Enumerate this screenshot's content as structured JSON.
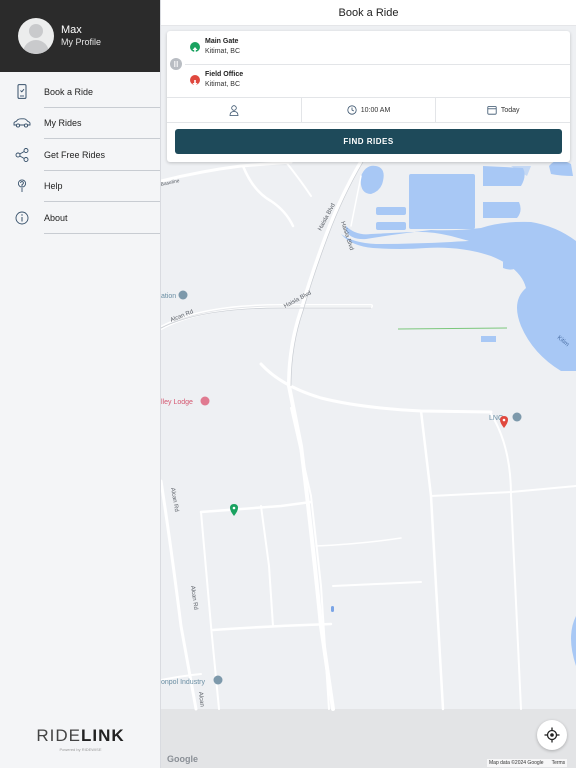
{
  "profile": {
    "name": "Max",
    "subtitle": "My Profile"
  },
  "menu": [
    {
      "label": "Book a Ride",
      "icon": "phone-icon"
    },
    {
      "label": "My Rides",
      "icon": "car-icon"
    },
    {
      "label": "Get Free Rides",
      "icon": "share-icon"
    },
    {
      "label": "Help",
      "icon": "help-icon"
    },
    {
      "label": "About",
      "icon": "info-icon"
    }
  ],
  "brand": {
    "name_light": "RIDE",
    "name_bold": "LINK",
    "powered_by": "Powered by RIDEWISE"
  },
  "header": {
    "title": "Book a Ride"
  },
  "ride": {
    "origin": {
      "name": "Main Gate",
      "city": "Kitimat, BC"
    },
    "destination": {
      "name": "Field Office",
      "city": "Kitimat, BC"
    },
    "time": "10:00 AM",
    "date": "Today",
    "find_label": "FIND RIDES"
  },
  "map_labels": {
    "haisla_blvd_1": "Haisla Blvd",
    "haisla_blvd_2": "Haisla Blvd",
    "haisla_blvd_3": "Haisla Blvd",
    "alcan_rd_1": "Alcan Rd",
    "alcan_rd_2": "Alcan Rd",
    "alcan_rd_3": "Alcan Rd",
    "alcan_rd_4": "Alcan",
    "station": "ation",
    "lodge": "lley Lodge",
    "lng": "LNG",
    "industry": "onpol Industry",
    "kitimat": "Kitim",
    "shoreline": "Baseline"
  },
  "attribution": {
    "map_data": "Map data ©2024 Google",
    "terms": "Terms",
    "logo": "Google"
  },
  "colors": {
    "sidebar_dark": "#2b2b2b",
    "button": "#1e4a5a",
    "water": "#a8c8f5",
    "origin_pin": "#1aa260",
    "dest_pin": "#e0483e"
  }
}
